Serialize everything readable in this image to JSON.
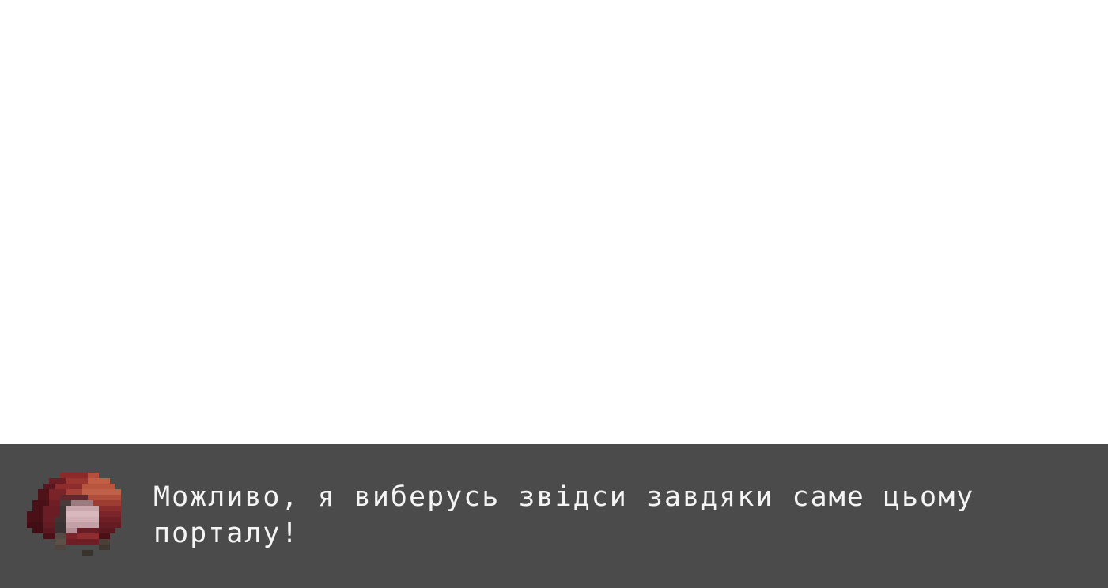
{
  "dialog": {
    "speaker_portrait_icon": "red-hooded-girl-portrait-icon",
    "text": "Можливо, я виберусь звідси завдяки саме цьому порталу!"
  },
  "colors": {
    "dialog_background": "#4b4b4b",
    "text": "#f4f4f4",
    "scene_background": "#ffffff"
  }
}
